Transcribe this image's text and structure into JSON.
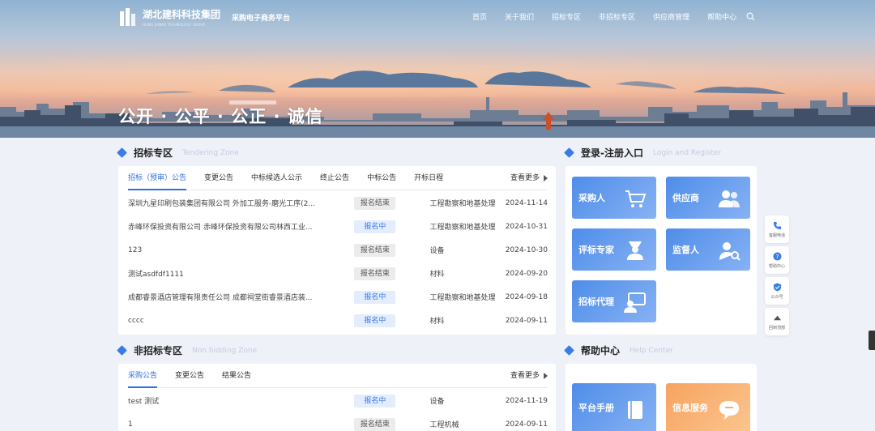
{
  "header": {
    "logo_cn": "湖北建科科技集团",
    "logo_en": "HUBEI JIANKE TECHNOLOGY GROUP",
    "platform": "采购电子商务平台",
    "nav": [
      "首页",
      "关于我们",
      "招标专区",
      "非招标专区",
      "供应商管理",
      "帮助中心"
    ],
    "slogan": "公开 · 公平 · 公正 · 诚信"
  },
  "tendering": {
    "title": "招标专区",
    "title_en": "Tendering Zone",
    "tabs": [
      "招标（预审）公告",
      "变更公告",
      "中标候选人公示",
      "终止公告",
      "中标公告",
      "开标日程"
    ],
    "more": "查看更多",
    "rows": [
      {
        "title": "深圳九星印刷包装集团有限公司 外加工服务-磨光工序(2...",
        "status": "报名结束",
        "status_type": "ended",
        "category": "工程勘察和地基处理",
        "date": "2024-11-14"
      },
      {
        "title": "赤峰环保投资有限公司 赤峰环保投资有限公司林西工业...",
        "status": "报名中",
        "status_type": "open",
        "category": "工程勘察和地基处理",
        "date": "2024-10-31"
      },
      {
        "title": "123",
        "status": "报名结束",
        "status_type": "ended",
        "category": "设备",
        "date": "2024-10-30"
      },
      {
        "title": "测试asdfdf1111",
        "status": "报名结束",
        "status_type": "ended",
        "category": "材料",
        "date": "2024-09-20"
      },
      {
        "title": "成都睿景酒店管理有限责任公司 成都祠堂街睿景酒店装...",
        "status": "报名中",
        "status_type": "open",
        "category": "工程勘察和地基处理",
        "date": "2024-09-18"
      },
      {
        "title": "cccc",
        "status": "报名中",
        "status_type": "open",
        "category": "材料",
        "date": "2024-09-11"
      }
    ]
  },
  "nonbidding": {
    "title": "非招标专区",
    "title_en": "Non bidding Zone",
    "tabs": [
      "采购公告",
      "变更公告",
      "结果公告"
    ],
    "more": "查看更多",
    "rows": [
      {
        "title": "test 测试",
        "status": "报名中",
        "status_type": "open",
        "category": "设备",
        "date": "2024-11-19"
      },
      {
        "title": "1",
        "status": "报名结束",
        "status_type": "ended",
        "category": "工程机械",
        "date": "2024-09-11"
      }
    ]
  },
  "login": {
    "title": "登录-注册入口",
    "title_en": "Login and Register",
    "tiles": [
      "采购人",
      "供应商",
      "评标专家",
      "监督人",
      "招标代理"
    ]
  },
  "help": {
    "title": "帮助中心",
    "title_en": "Help Center",
    "tiles": [
      "平台手册",
      "信息服务"
    ]
  },
  "floatbar": [
    "客服电话",
    "帮助中心",
    "公众号",
    "回到顶部"
  ],
  "colors": {
    "accent": "#2f6fe0",
    "tile_blue": "#5b95ec",
    "tile_orange": "#f7a35f"
  }
}
